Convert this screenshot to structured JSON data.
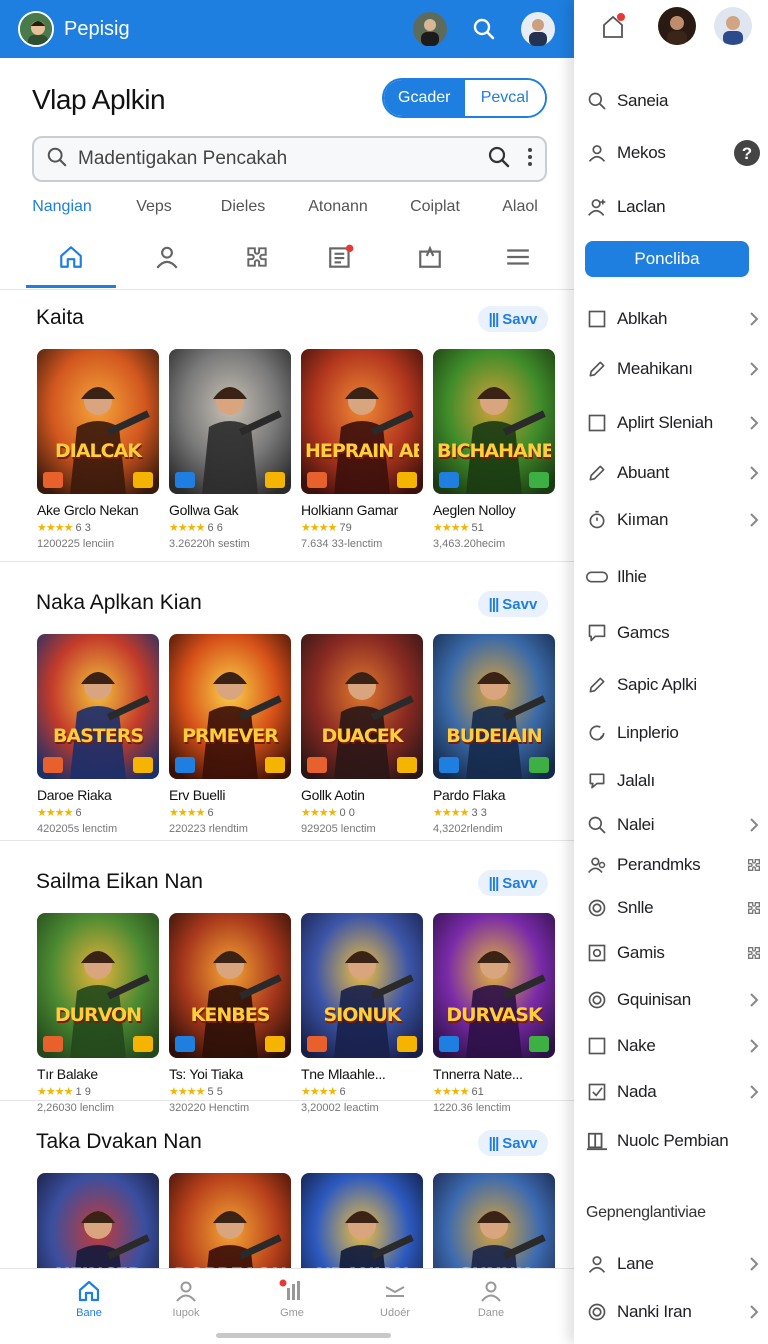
{
  "header": {
    "title": "Pepisig",
    "icons": [
      "avatar",
      "user-avatar",
      "search-icon",
      "user-avatar"
    ]
  },
  "main": {
    "app_title": "Vlap Aplkin",
    "toggle": {
      "left": "Gcader",
      "right": "Pevcal",
      "selected": "left"
    },
    "search": {
      "placeholder": "Madentigakan Pencakah"
    },
    "categories": [
      "Nangian",
      "Veps",
      "Dieles",
      "Atonann",
      "Coiplat",
      "Alaol"
    ],
    "active_category": 0,
    "icon_tabs": [
      "home-icon",
      "person-icon",
      "puzzle-icon",
      "news-icon",
      "share-icon",
      "menu-icon"
    ],
    "sections": [
      {
        "title": "Kaita",
        "save_label": "Savv",
        "apps": [
          {
            "art": "DIALCAK",
            "name": "Ake Grclo Nekan",
            "rating": "6 3",
            "downloads": "1200225 lenciin",
            "palette": [
              "#3a1a0c",
              "#d2571f",
              "#f6a53a"
            ]
          },
          {
            "art": "",
            "name": "Gollwa Gak",
            "rating": "6 6",
            "downloads": "3.26220h sestim",
            "palette": [
              "#2b2b2b",
              "#7a7a7a",
              "#c7c1b6"
            ]
          },
          {
            "art": "HEPRAIN ABEA",
            "name": "Holkiann Gamar",
            "rating": "79",
            "downloads": "7.634 33-lenctim",
            "palette": [
              "#3c100c",
              "#b3371e",
              "#f08a35"
            ]
          },
          {
            "art": "BICHAHANE",
            "name": "Aeglen Nolloy",
            "rating": "51",
            "downloads": "3,463.20hecim",
            "palette": [
              "#1b3a12",
              "#3f8c2a",
              "#d3a23a"
            ]
          }
        ]
      },
      {
        "title": "Naka Aplkan Kian",
        "save_label": "Savv",
        "apps": [
          {
            "art": "BASTERS",
            "name": "Daroe Riaka",
            "rating": "6",
            "downloads": "420205s lenctim",
            "palette": [
              "#1b2f6a",
              "#c33b2a",
              "#f4c23c"
            ]
          },
          {
            "art": "PRMEVER",
            "name": "Erv Buelli",
            "rating": "6",
            "downloads": "220223 rlendtim",
            "palette": [
              "#3a1008",
              "#d65018",
              "#fbd148"
            ]
          },
          {
            "art": "DUACEK",
            "name": "Gollk Aotin",
            "rating": "0 0",
            "downloads": "929205 lenctim",
            "palette": [
              "#2a1616",
              "#8a2a22",
              "#e0782e"
            ]
          },
          {
            "art": "BUDEIAIN",
            "name": "Pardo Flaka",
            "rating": "3 3",
            "downloads": "4,3202rlendim",
            "palette": [
              "#15294a",
              "#3b6aa8",
              "#d9a43c"
            ]
          }
        ]
      },
      {
        "title": "Sailma Eikan Nan",
        "save_label": "Savv",
        "apps": [
          {
            "art": "DURVON",
            "name": "Tır Balake",
            "rating": "1 9",
            "downloads": "2,26030 lenclim",
            "palette": [
              "#23481c",
              "#4c8a32",
              "#e6b43a"
            ]
          },
          {
            "art": "KENBES",
            "name": "Ts: Yoi Tiaka",
            "rating": "5 5",
            "downloads": "320220 Henctim",
            "palette": [
              "#2b0f08",
              "#a8381c",
              "#f6a533"
            ]
          },
          {
            "art": "SIONUK",
            "name": "Tne Mlaahle...",
            "rating": "6",
            "downloads": "3,20002 leactim",
            "palette": [
              "#18204a",
              "#3c55a8",
              "#f0c040"
            ]
          },
          {
            "art": "DURVASK",
            "name": "Tnnerra Nate...",
            "rating": "61",
            "downloads": "1220.36 lenctim",
            "palette": [
              "#2c1146",
              "#7a2aa8",
              "#e2b53c"
            ]
          }
        ]
      },
      {
        "title": "Taka Dvakan Nan",
        "save_label": "Savv",
        "apps": [
          {
            "art": "NEINCER",
            "name": "",
            "rating": "",
            "downloads": "",
            "palette": [
              "#161a3a",
              "#3a4fa0",
              "#c53a36"
            ]
          },
          {
            "art": "DOPREAON",
            "name": "",
            "rating": "",
            "downloads": "",
            "palette": [
              "#3a0e08",
              "#b8411b",
              "#f6a535"
            ]
          },
          {
            "art": "NDANIAN",
            "name": "",
            "rating": "",
            "downloads": "",
            "palette": [
              "#101a3a",
              "#2d5ac0",
              "#f0c040"
            ]
          },
          {
            "art": "SUNUK",
            "name": "",
            "rating": "",
            "downloads": "",
            "palette": [
              "#1a2448",
              "#3c6ab0",
              "#d8a43c"
            ]
          }
        ]
      }
    ]
  },
  "bottom_nav": [
    {
      "label": "Bane",
      "icon": "home-icon",
      "active": true
    },
    {
      "label": "Iupok",
      "icon": "person-icon",
      "active": false
    },
    {
      "label": "Gme",
      "icon": "chart-icon",
      "active": false
    },
    {
      "label": "Udoér",
      "icon": "inbox-icon",
      "active": false
    },
    {
      "label": "Dane",
      "icon": "person-icon",
      "active": false
    }
  ],
  "drawer": {
    "top_icons": [
      "notification-icon",
      "user-avatar",
      "user-avatar"
    ],
    "items_top": [
      {
        "label": "Saneia",
        "icon": "search-icon"
      },
      {
        "label": "Mekos",
        "icon": "person-icon",
        "trail": "help-icon"
      },
      {
        "label": "Laclan",
        "icon": "person-add-icon"
      }
    ],
    "primary_button": "Poncliba",
    "items": [
      {
        "label": "Ablkah",
        "icon": "square-icon",
        "chevron": true
      },
      {
        "label": "Meahikanı",
        "icon": "pencil-icon",
        "chevron": true
      },
      {
        "label": "Aplirt Sleniah",
        "icon": "square-icon",
        "chevron": true
      },
      {
        "label": "Abuant",
        "icon": "pencil-icon",
        "chevron": true
      },
      {
        "label": "Kiıman",
        "icon": "timer-icon",
        "chevron": true
      },
      {
        "label": "Ilhie",
        "icon": "toggle-icon",
        "chevron": false
      },
      {
        "label": "Gamcs",
        "icon": "chat-icon",
        "chevron": false
      },
      {
        "label": "Sapic Aplki",
        "icon": "pencil-icon",
        "chevron": false
      },
      {
        "label": "Linplerio",
        "icon": "refresh-icon",
        "chevron": false
      },
      {
        "label": "Jalalı",
        "icon": "bubble-icon",
        "chevron": false
      },
      {
        "label": "Nalei",
        "icon": "search-icon",
        "chevron": true
      },
      {
        "label": "Perandmks",
        "icon": "people-icon",
        "chevron": false,
        "trail": "puzzle-icon"
      },
      {
        "label": "Snlle",
        "icon": "target-icon",
        "chevron": false,
        "trail": "puzzle-icon"
      },
      {
        "label": "Gamis",
        "icon": "frame-icon",
        "chevron": false,
        "trail": "puzzle-icon"
      },
      {
        "label": "Gquinisan",
        "icon": "target-icon",
        "chevron": true
      },
      {
        "label": "Nake",
        "icon": "square-icon",
        "chevron": true
      },
      {
        "label": "Nada",
        "icon": "check-square-icon",
        "chevron": true
      },
      {
        "label": "Nuolc Pembian",
        "icon": "book-icon",
        "chevron": false
      }
    ],
    "group_heading": "Gepnenglantiviae",
    "items_bottom": [
      {
        "label": "Lane",
        "icon": "person-icon",
        "chevron": true
      },
      {
        "label": "Nanki Iran",
        "icon": "target-icon",
        "chevron": true
      }
    ]
  },
  "colors": {
    "accent": "#1e7fe0",
    "star": "#f4b400"
  }
}
